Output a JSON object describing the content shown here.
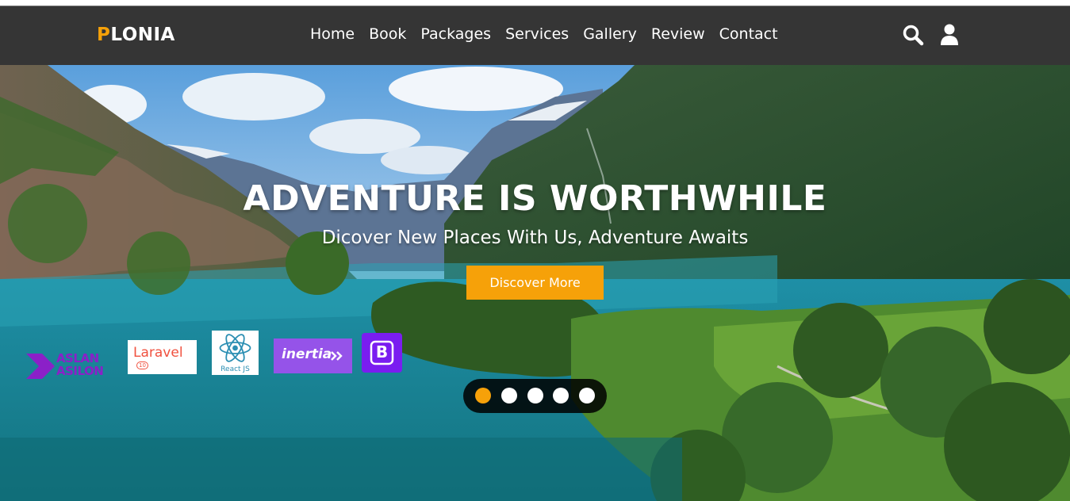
{
  "header": {
    "logo_first": "P",
    "logo_rest": "LONIA",
    "nav": [
      {
        "label": "Home"
      },
      {
        "label": "Book"
      },
      {
        "label": "Packages"
      },
      {
        "label": "Services"
      },
      {
        "label": "Gallery"
      },
      {
        "label": "Review"
      },
      {
        "label": "Contact"
      }
    ],
    "icons": [
      "search-icon",
      "user-icon"
    ]
  },
  "hero": {
    "title": "ADVENTURE IS WORTHWHILE",
    "subtitle": "Dicover New Places With Us, Adventure Awaits",
    "cta_label": "Discover More",
    "slider": {
      "count": 5,
      "active_index": 0
    }
  },
  "tech_logos": {
    "aslan": "ASLAN ASILON",
    "laravel": "Laravel",
    "laravel_version": "10",
    "react": "React JS",
    "inertia": "inertia",
    "bootstrap": "B"
  },
  "colors": {
    "accent": "#f6a109",
    "header_bg": "#353535",
    "text": "#ffffff"
  }
}
